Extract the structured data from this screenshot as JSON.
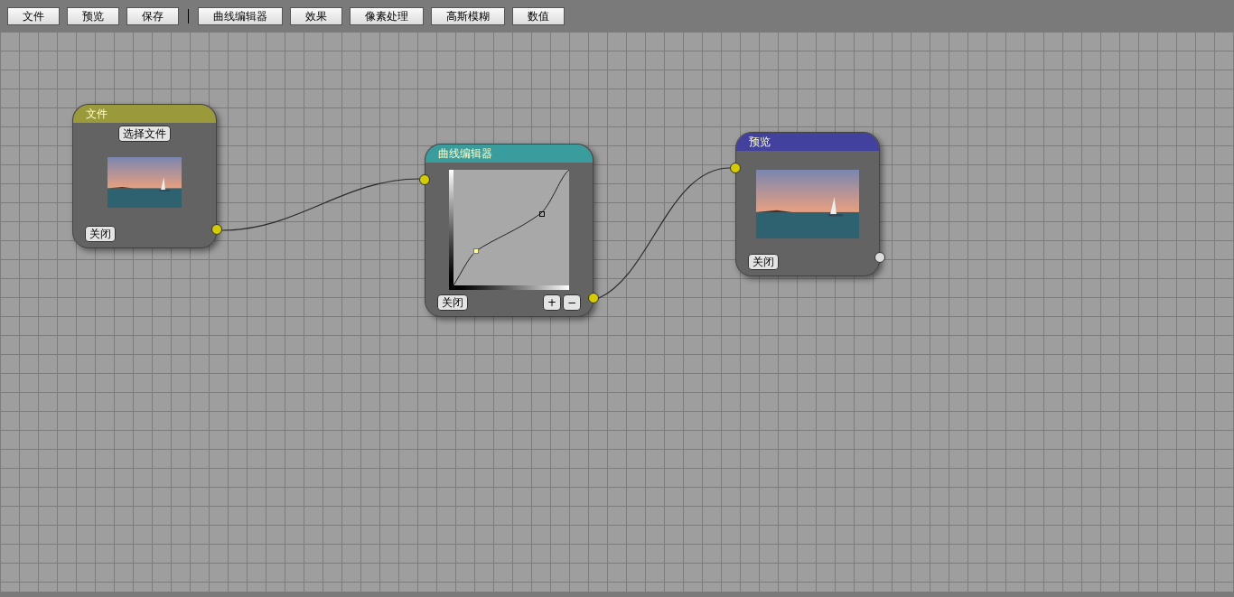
{
  "toolbar": [
    {
      "kind": "button",
      "label": "文件"
    },
    {
      "kind": "button",
      "label": "预览"
    },
    {
      "kind": "button",
      "label": "保存"
    },
    {
      "kind": "separator"
    },
    {
      "kind": "button",
      "label": "曲线编辑器"
    },
    {
      "kind": "button",
      "label": "效果"
    },
    {
      "kind": "button",
      "label": "像素处理"
    },
    {
      "kind": "button",
      "label": "高斯模糊"
    },
    {
      "kind": "button",
      "label": "数值"
    }
  ],
  "nodes": [
    {
      "kind": "file",
      "title": "文件",
      "color": "#9a9a3c",
      "select_button": "选择文件",
      "close_button": "关闭",
      "output_connected": true
    },
    {
      "kind": "curve",
      "title": "曲线编辑器",
      "color": "#3a9c9c",
      "close_button": "关闭",
      "add_button": "+",
      "remove_button": "−",
      "input_connected": true,
      "output_connected": true,
      "points": [
        {
          "selected": true
        },
        {
          "selected": false
        }
      ]
    },
    {
      "kind": "preview",
      "title": "预览",
      "color": "#42429e",
      "close_button": "关闭",
      "input_connected": true,
      "output_connected": false
    }
  ]
}
